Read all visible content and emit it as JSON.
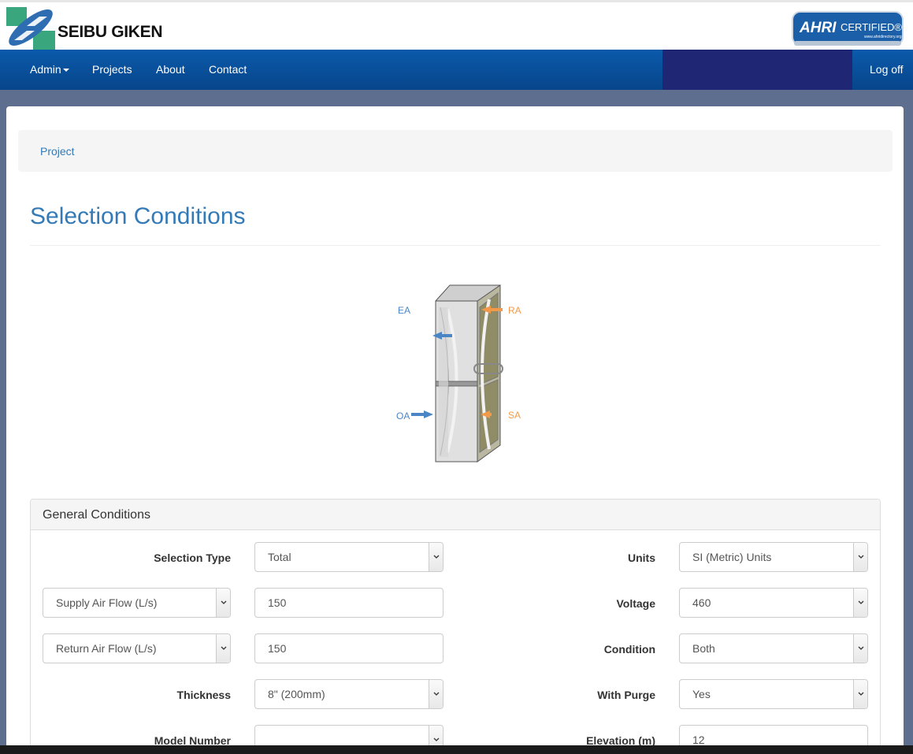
{
  "header": {
    "brand": "SEIBU GIKEN",
    "certification_badge": "AHRI CERTIFIED"
  },
  "nav": {
    "items": [
      {
        "label": "Admin",
        "has_dropdown": true
      },
      {
        "label": "Projects"
      },
      {
        "label": "About"
      },
      {
        "label": "Contact"
      }
    ],
    "logoff": "Log off"
  },
  "breadcrumb": {
    "link": "Project"
  },
  "page": {
    "title": "Selection Conditions"
  },
  "diagram": {
    "labels": {
      "ea": "EA",
      "ra": "RA",
      "oa": "OA",
      "sa": "SA"
    }
  },
  "general_conditions": {
    "title": "General Conditions",
    "left": {
      "selection_type": {
        "label": "Selection Type",
        "value": "Total"
      },
      "supply_air_flow": {
        "selector": "Supply Air Flow (L/s)",
        "value": "150"
      },
      "return_air_flow": {
        "selector": "Return Air Flow (L/s)",
        "value": "150"
      },
      "thickness": {
        "label": "Thickness",
        "value": "8\" (200mm)"
      },
      "model_number": {
        "label": "Model Number",
        "value": ""
      }
    },
    "right": {
      "units": {
        "label": "Units",
        "value": "SI (Metric) Units"
      },
      "voltage": {
        "label": "Voltage",
        "value": "460"
      },
      "condition": {
        "label": "Condition",
        "value": "Both"
      },
      "with_purge": {
        "label": "With Purge",
        "value": "Yes"
      },
      "elevation": {
        "label": "Elevation (m)",
        "value": "12"
      }
    }
  },
  "colors": {
    "nav": "#0b5aab",
    "nav_dark": "#1f2673",
    "link": "#337ab7",
    "exhaust_arrow": "#4a86c5",
    "supply_arrow": "#f29a4a"
  }
}
